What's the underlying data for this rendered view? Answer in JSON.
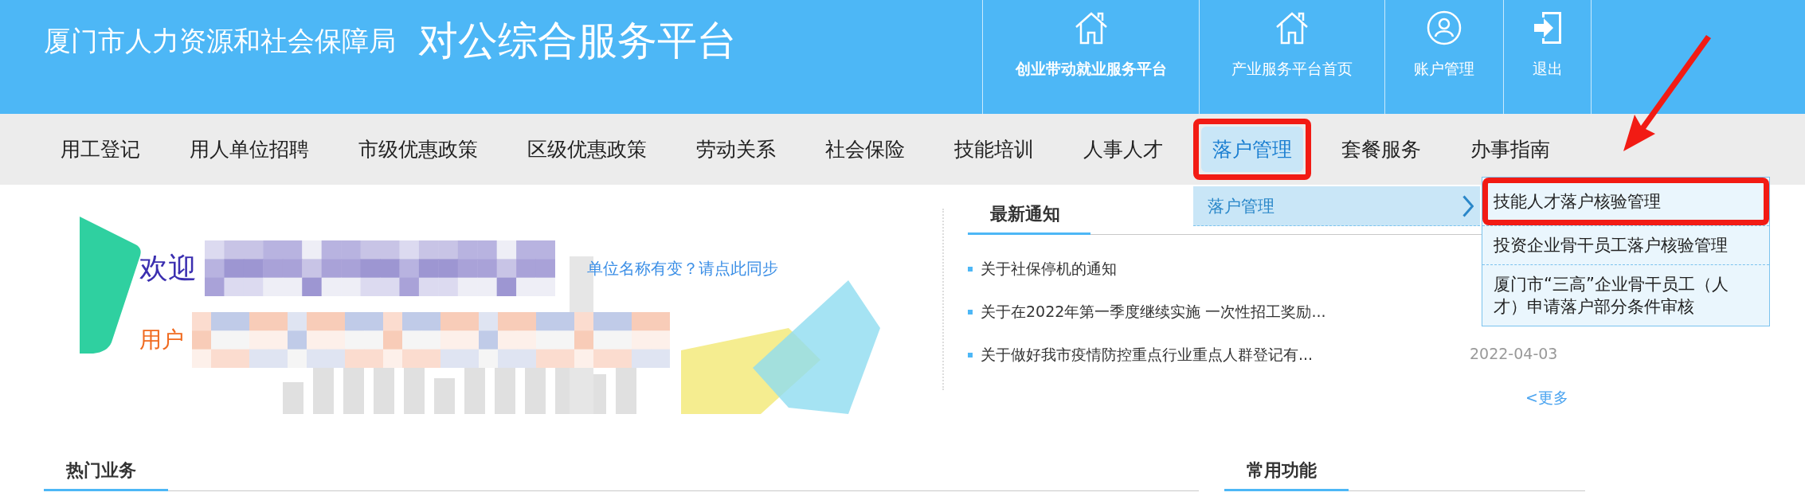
{
  "header": {
    "org": "厦门市人力资源和社会保障局",
    "platform": "对公综合服务平台",
    "links": [
      {
        "label": "创业带动就业服务平台",
        "bold": true
      },
      {
        "label": "产业服务平台首页",
        "bold": false
      },
      {
        "label": "账户管理",
        "bold": false
      },
      {
        "label": "退出",
        "bold": false
      }
    ]
  },
  "nav": [
    {
      "label": "用工登记",
      "selected": false,
      "highlighted": false
    },
    {
      "label": "用人单位招聘",
      "selected": false,
      "highlighted": false
    },
    {
      "label": "市级优惠政策",
      "selected": false,
      "highlighted": false
    },
    {
      "label": "区级优惠政策",
      "selected": false,
      "highlighted": false
    },
    {
      "label": "劳动关系",
      "selected": false,
      "highlighted": false
    },
    {
      "label": "社会保险",
      "selected": false,
      "highlighted": false
    },
    {
      "label": "技能培训",
      "selected": false,
      "highlighted": false
    },
    {
      "label": "人事人才",
      "selected": false,
      "highlighted": false
    },
    {
      "label": "落户管理",
      "selected": true,
      "highlighted": true
    },
    {
      "label": "套餐服务",
      "selected": false,
      "highlighted": false
    },
    {
      "label": "办事指南",
      "selected": false,
      "highlighted": false
    }
  ],
  "dropdown": {
    "label": "落户管理",
    "submenu": [
      {
        "label": "技能人才落户核验管理",
        "highlighted": true
      },
      {
        "label": "投资企业骨干员工落户核验管理",
        "highlighted": false
      },
      {
        "label": "厦门市“三高”企业骨干员工（人才）申请落户部分条件审核",
        "highlighted": false
      }
    ]
  },
  "welcome": {
    "greeting": "欢迎",
    "user_label": "用户",
    "sync_link": "单位名称有变？请点此同步"
  },
  "notices": {
    "title": "最新通知",
    "items": [
      {
        "text": "关于社保停机的通知"
      },
      {
        "text": "关于在2022年第一季度继续实施 一次性招工奖励..."
      },
      {
        "text": "关于做好我市疫情防控重点行业重点人群登记有...",
        "date": "2022-04-03"
      }
    ],
    "more": "<更多"
  },
  "sections": [
    {
      "title": "热门业务"
    },
    {
      "title": "常用功能"
    }
  ]
}
